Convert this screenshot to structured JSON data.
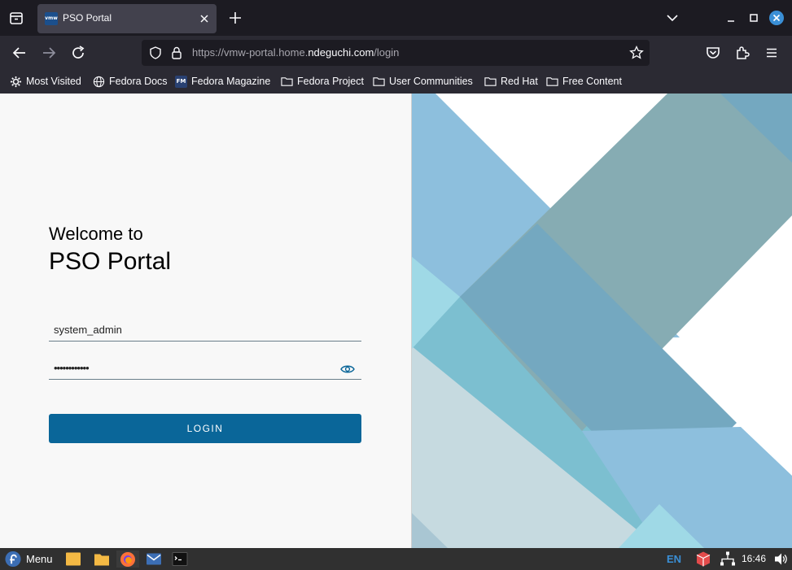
{
  "browser": {
    "tab_title": "PSO Portal",
    "tab_favicon_text": "vmw",
    "url_prefix": "https://vmw-portal.home.",
    "url_domain": "ndeguchi.com",
    "url_path": "/login"
  },
  "bookmarks": [
    {
      "label": "Most Visited",
      "icon": "gear-icon"
    },
    {
      "label": "Fedora Docs",
      "icon": "globe-icon"
    },
    {
      "label": "Fedora Magazine",
      "icon": "fedora-magazine-icon",
      "icon_text": "FM"
    },
    {
      "label": "Fedora Project",
      "icon": "folder-icon"
    },
    {
      "label": "User Communities",
      "icon": "folder-icon"
    },
    {
      "label": "Red Hat",
      "icon": "folder-icon"
    },
    {
      "label": "Free Content",
      "icon": "folder-icon"
    }
  ],
  "login": {
    "welcome": "Welcome to",
    "title": "PSO Portal",
    "username": "system_admin",
    "password_mask": "••••••••••••",
    "button_label": "LOGIN"
  },
  "taskbar": {
    "menu_label": "Menu",
    "language": "EN",
    "time": "16:46"
  },
  "colors": {
    "accent": "#0a6699",
    "tab_bg": "#42414d",
    "toolbar_bg": "#2b2a33",
    "taskbar_bg": "#303030"
  }
}
